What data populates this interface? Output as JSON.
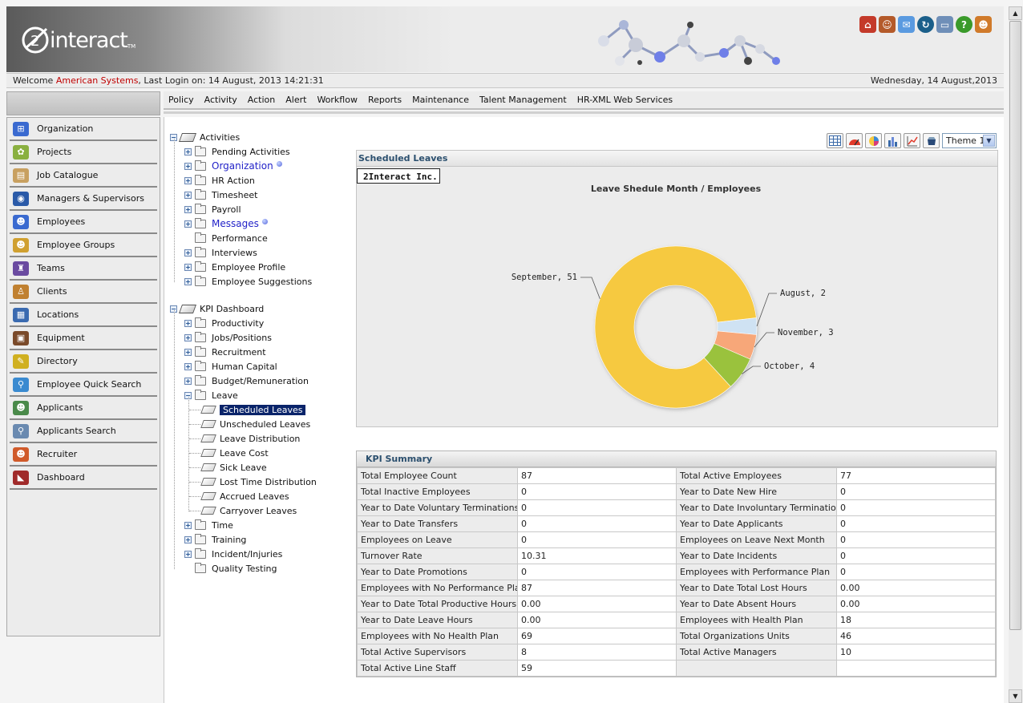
{
  "header": {
    "logo_text": "interact",
    "logo_tm": "TM",
    "icons": [
      "home-icon",
      "user-icon",
      "mail-icon",
      "refresh-icon",
      "computer-icon",
      "help-icon",
      "logout-user-icon"
    ]
  },
  "welcome": {
    "prefix": "Welcome",
    "company": "American Systems",
    "last_login": ", Last Login on: 14 August, 2013 14:21:31",
    "date": "Wednesday, 14 August,2013"
  },
  "menu": [
    "Policy",
    "Activity",
    "Action",
    "Alert",
    "Workflow",
    "Reports",
    "Maintenance",
    "Talent Management",
    "HR-XML Web Services"
  ],
  "sidebar": [
    {
      "label": "Organization",
      "icon": "organization-icon"
    },
    {
      "label": "Projects",
      "icon": "projects-icon"
    },
    {
      "label": "Job Catalogue",
      "icon": "job-catalogue-icon"
    },
    {
      "label": "Managers & Supervisors",
      "icon": "managers-icon"
    },
    {
      "label": "Employees",
      "icon": "employees-icon"
    },
    {
      "label": "Employee Groups",
      "icon": "employee-groups-icon"
    },
    {
      "label": "Teams",
      "icon": "teams-icon"
    },
    {
      "label": "Clients",
      "icon": "clients-icon"
    },
    {
      "label": "Locations",
      "icon": "locations-icon"
    },
    {
      "label": "Equipment",
      "icon": "equipment-icon"
    },
    {
      "label": "Directory",
      "icon": "directory-icon"
    },
    {
      "label": "Employee Quick Search",
      "icon": "employee-quick-search-icon"
    },
    {
      "label": "Applicants",
      "icon": "applicants-icon"
    },
    {
      "label": "Applicants Search",
      "icon": "applicants-search-icon"
    },
    {
      "label": "Recruiter",
      "icon": "recruiter-icon"
    },
    {
      "label": "Dashboard",
      "icon": "dashboard-icon"
    }
  ],
  "tree": {
    "activities_root": "Activities",
    "activities": [
      {
        "label": "Pending Activities",
        "expandable": true
      },
      {
        "label": "Organization",
        "expandable": true,
        "link": true
      },
      {
        "label": "HR Action",
        "expandable": true
      },
      {
        "label": "Timesheet",
        "expandable": true
      },
      {
        "label": "Payroll",
        "expandable": true
      },
      {
        "label": "Messages",
        "expandable": true,
        "link": true
      },
      {
        "label": "Performance",
        "expandable": false
      },
      {
        "label": "Interviews",
        "expandable": true
      },
      {
        "label": "Employee Profile",
        "expandable": true
      },
      {
        "label": "Employee Suggestions",
        "expandable": true
      }
    ],
    "kpi_root": "KPI Dashboard",
    "kpi": [
      {
        "label": "Productivity",
        "expandable": true
      },
      {
        "label": "Jobs/Positions",
        "expandable": true
      },
      {
        "label": "Recruitment",
        "expandable": true
      },
      {
        "label": "Human Capital",
        "expandable": true
      },
      {
        "label": "Budget/Remuneration",
        "expandable": true
      },
      {
        "label": "Leave",
        "expandable": true,
        "open": true
      }
    ],
    "leave": [
      "Scheduled Leaves",
      "Unscheduled Leaves",
      "Leave Distribution",
      "Leave Cost",
      "Sick Leave",
      "Lost Time Distribution",
      "Accrued Leaves",
      "Carryover Leaves"
    ],
    "leave_selected": "Scheduled Leaves",
    "kpi_after": [
      {
        "label": "Time",
        "expandable": true
      },
      {
        "label": "Training",
        "expandable": true
      },
      {
        "label": "Incident/Injuries",
        "expandable": true
      },
      {
        "label": "Quality Testing",
        "expandable": false
      }
    ]
  },
  "chart_tools": {
    "icons": [
      "table-view-icon",
      "gauge-chart-icon",
      "pie-chart-icon",
      "bar-chart-icon",
      "line-chart-icon",
      "export-icon"
    ],
    "theme_value": "Theme 1"
  },
  "chart_panel": {
    "header": "Scheduled Leaves",
    "company_tag": "2Interact Inc."
  },
  "chart_data": {
    "type": "pie",
    "title": "Leave Shedule Month / Employees",
    "donut": true,
    "slices": [
      {
        "label": "September",
        "value": 51,
        "color": "#f6c940"
      },
      {
        "label": "August",
        "value": 2,
        "color": "#cfe2f3"
      },
      {
        "label": "November",
        "value": 3,
        "color": "#f7a779"
      },
      {
        "label": "October",
        "value": 4,
        "color": "#9ac23c"
      }
    ]
  },
  "kpi": {
    "title": "KPI Summary",
    "rows": [
      [
        "Total Employee Count",
        "87",
        "Total Active Employees",
        "77"
      ],
      [
        "Total Inactive Employees",
        "0",
        "Year to Date New Hire",
        "0"
      ],
      [
        "Year to Date Voluntary Terminations",
        "0",
        "Year to Date Involuntary Terminations",
        "0"
      ],
      [
        "Year to Date Transfers",
        "0",
        "Year to Date Applicants",
        "0"
      ],
      [
        "Employees on Leave",
        "0",
        "Employees on Leave Next Month",
        "0"
      ],
      [
        "Turnover Rate",
        "10.31",
        "Year to Date Incidents",
        "0"
      ],
      [
        "Year to Date Promotions",
        "0",
        "Employees with Performance Plan",
        "0"
      ],
      [
        "Employees with No Performance Plan",
        "87",
        "Year to Date Total Lost Hours",
        "0.00"
      ],
      [
        "Year to Date Total Productive Hours",
        "0.00",
        "Year to Date Absent Hours",
        "0.00"
      ],
      [
        "Year to Date Leave Hours",
        "0.00",
        "Employees with Health Plan",
        "18"
      ],
      [
        "Employees with No Health Plan",
        "69",
        "Total Organizations Units",
        "46"
      ],
      [
        "Total Active Supervisors",
        "8",
        "Total Active Managers",
        "10"
      ],
      [
        "Total Active Line Staff",
        "59",
        "",
        ""
      ]
    ]
  }
}
